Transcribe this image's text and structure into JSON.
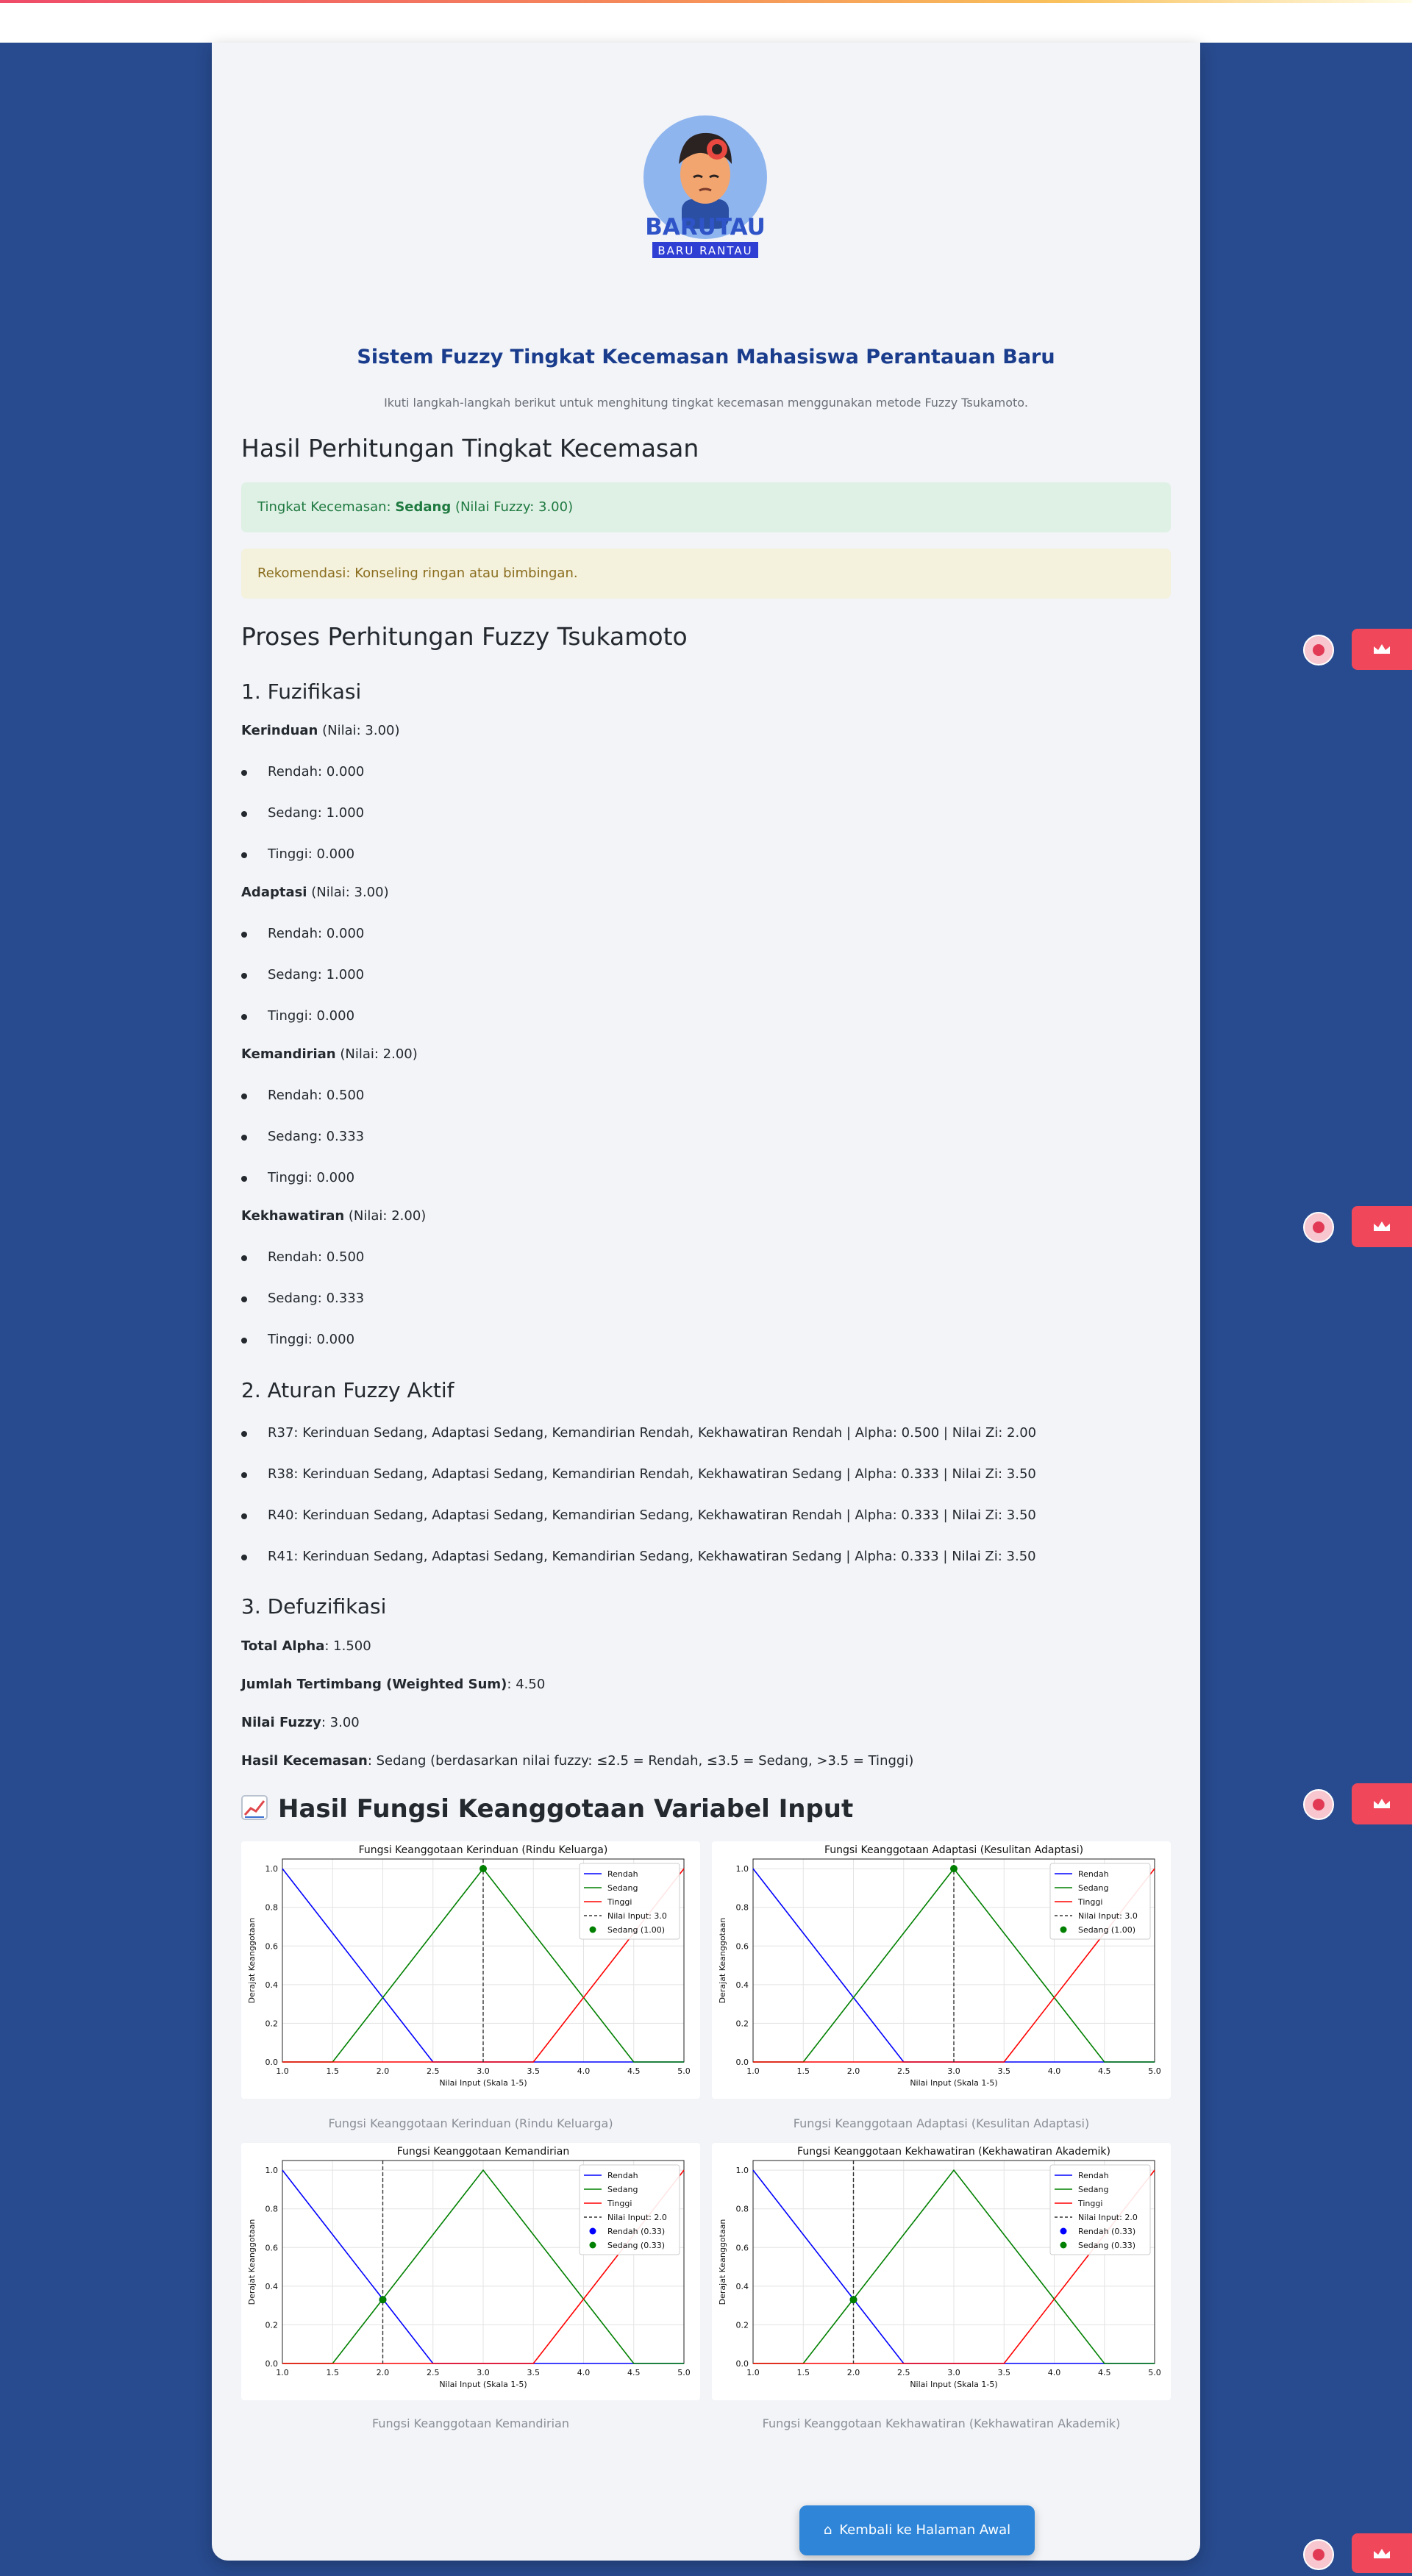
{
  "header": {
    "app_name": "BARUTAU",
    "app_tagline": "BARU RANTAU",
    "title": "Sistem Fuzzy Tingkat Kecemasan Mahasiswa Perantauan Baru",
    "subtitle": "Ikuti langkah-langkah berikut untuk menghitung tingkat kecemasan menggunakan metode Fuzzy Tsukamoto."
  },
  "result": {
    "heading": "Hasil Perhitungan Tingkat Kecemasan",
    "level_prefix": "Tingkat Kecemasan: ",
    "level_value": "Sedang",
    "level_suffix": " (Nilai Fuzzy: 3.00)",
    "recommendation": "Rekomendasi: Konseling ringan atau bimbingan."
  },
  "process": {
    "heading": "Proses Perhitungan Fuzzy Tsukamoto",
    "fuzzification_heading": "1. Fuzifikasi",
    "variables": [
      {
        "name": "Kerinduan",
        "value_text": " (Nilai: 3.00)",
        "memberships": [
          "Rendah: 0.000",
          "Sedang: 1.000",
          "Tinggi: 0.000"
        ]
      },
      {
        "name": "Adaptasi",
        "value_text": " (Nilai: 3.00)",
        "memberships": [
          "Rendah: 0.000",
          "Sedang: 1.000",
          "Tinggi: 0.000"
        ]
      },
      {
        "name": "Kemandirian",
        "value_text": " (Nilai: 2.00)",
        "memberships": [
          "Rendah: 0.500",
          "Sedang: 0.333",
          "Tinggi: 0.000"
        ]
      },
      {
        "name": "Kekhawatiran",
        "value_text": " (Nilai: 2.00)",
        "memberships": [
          "Rendah: 0.500",
          "Sedang: 0.333",
          "Tinggi: 0.000"
        ]
      }
    ],
    "rules_heading": "2. Aturan Fuzzy Aktif",
    "rules": [
      "R37: Kerinduan Sedang, Adaptasi Sedang, Kemandirian Rendah, Kekhawatiran Rendah | Alpha: 0.500 | Nilai Zi: 2.00",
      "R38: Kerinduan Sedang, Adaptasi Sedang, Kemandirian Rendah, Kekhawatiran Sedang | Alpha: 0.333 | Nilai Zi: 3.50",
      "R40: Kerinduan Sedang, Adaptasi Sedang, Kemandirian Sedang, Kekhawatiran Rendah | Alpha: 0.333 | Nilai Zi: 3.50",
      "R41: Kerinduan Sedang, Adaptasi Sedang, Kemandirian Sedang, Kekhawatiran Sedang | Alpha: 0.333 | Nilai Zi: 3.50"
    ],
    "defuzz_heading": "3. Defuzifikasi",
    "defuzz": [
      {
        "label": "Total Alpha",
        "value": ": 1.500"
      },
      {
        "label": "Jumlah Tertimbang (Weighted Sum)",
        "value": ": 4.50"
      },
      {
        "label": "Nilai Fuzzy",
        "value": ": 3.00"
      },
      {
        "label": "Hasil Kecemasan",
        "value": ": Sedang (berdasarkan nilai fuzzy: ≤2.5 = Rendah, ≤3.5 = Sedang, >3.5 = Tinggi)"
      }
    ]
  },
  "charts_section": {
    "heading": "Hasil Fungsi Keanggotaan Variabel Input",
    "back_button": "Kembali ke Halaman Awal"
  },
  "chart_data": [
    {
      "type": "line",
      "title": "Fungsi Keanggotaan Kerinduan (Rindu Keluarga)",
      "caption": "Fungsi Keanggotaan Kerinduan (Rindu Keluarga)",
      "xlabel": "Nilai Input (Skala 1-5)",
      "ylabel": "Derajat Keanggotaan",
      "xlim": [
        1.0,
        5.0
      ],
      "ylim": [
        0.0,
        1.05
      ],
      "xticks": [
        "1.0",
        "1.5",
        "2.0",
        "2.5",
        "3.0",
        "3.5",
        "4.0",
        "4.5",
        "5.0"
      ],
      "yticks": [
        "0.0",
        "0.2",
        "0.4",
        "0.6",
        "0.8",
        "1.0"
      ],
      "grid": true,
      "legend": "top-right",
      "series": [
        {
          "name": "Rendah",
          "color": "#0000ff",
          "x": [
            1.0,
            2.5,
            5.0
          ],
          "y": [
            1.0,
            0.0,
            0.0
          ]
        },
        {
          "name": "Sedang",
          "color": "#008000",
          "x": [
            1.0,
            1.5,
            3.0,
            4.5,
            5.0
          ],
          "y": [
            0.0,
            0.0,
            1.0,
            0.0,
            0.0
          ]
        },
        {
          "name": "Tinggi",
          "color": "#ff0000",
          "x": [
            1.0,
            3.5,
            5.0
          ],
          "y": [
            0.0,
            0.0,
            1.0
          ]
        }
      ],
      "input_line": {
        "name": "Nilai Input: 3.0",
        "x": 3.0
      },
      "points": [
        {
          "name": "Sedang (1.00)",
          "x": 3.0,
          "y": 1.0,
          "color": "#008000"
        }
      ]
    },
    {
      "type": "line",
      "title": "Fungsi Keanggotaan Adaptasi (Kesulitan Adaptasi)",
      "caption": "Fungsi Keanggotaan Adaptasi (Kesulitan Adaptasi)",
      "xlabel": "Nilai Input (Skala 1-5)",
      "ylabel": "Derajat Keanggotaan",
      "xlim": [
        1.0,
        5.0
      ],
      "ylim": [
        0.0,
        1.05
      ],
      "xticks": [
        "1.0",
        "1.5",
        "2.0",
        "2.5",
        "3.0",
        "3.5",
        "4.0",
        "4.5",
        "5.0"
      ],
      "yticks": [
        "0.0",
        "0.2",
        "0.4",
        "0.6",
        "0.8",
        "1.0"
      ],
      "grid": true,
      "legend": "top-right",
      "series": [
        {
          "name": "Rendah",
          "color": "#0000ff",
          "x": [
            1.0,
            2.5,
            5.0
          ],
          "y": [
            1.0,
            0.0,
            0.0
          ]
        },
        {
          "name": "Sedang",
          "color": "#008000",
          "x": [
            1.0,
            1.5,
            3.0,
            4.5,
            5.0
          ],
          "y": [
            0.0,
            0.0,
            1.0,
            0.0,
            0.0
          ]
        },
        {
          "name": "Tinggi",
          "color": "#ff0000",
          "x": [
            1.0,
            3.5,
            5.0
          ],
          "y": [
            0.0,
            0.0,
            1.0
          ]
        }
      ],
      "input_line": {
        "name": "Nilai Input: 3.0",
        "x": 3.0
      },
      "points": [
        {
          "name": "Sedang (1.00)",
          "x": 3.0,
          "y": 1.0,
          "color": "#008000"
        }
      ]
    },
    {
      "type": "line",
      "title": "Fungsi Keanggotaan Kemandirian",
      "caption": "Fungsi Keanggotaan Kemandirian",
      "xlabel": "Nilai Input (Skala 1-5)",
      "ylabel": "Derajat Keanggotaan",
      "xlim": [
        1.0,
        5.0
      ],
      "ylim": [
        0.0,
        1.05
      ],
      "xticks": [
        "1.0",
        "1.5",
        "2.0",
        "2.5",
        "3.0",
        "3.5",
        "4.0",
        "4.5",
        "5.0"
      ],
      "yticks": [
        "0.0",
        "0.2",
        "0.4",
        "0.6",
        "0.8",
        "1.0"
      ],
      "grid": true,
      "legend": "top-right",
      "series": [
        {
          "name": "Rendah",
          "color": "#0000ff",
          "x": [
            1.0,
            2.5,
            5.0
          ],
          "y": [
            1.0,
            0.0,
            0.0
          ]
        },
        {
          "name": "Sedang",
          "color": "#008000",
          "x": [
            1.0,
            1.5,
            3.0,
            4.5,
            5.0
          ],
          "y": [
            0.0,
            0.0,
            1.0,
            0.0,
            0.0
          ]
        },
        {
          "name": "Tinggi",
          "color": "#ff0000",
          "x": [
            1.0,
            3.5,
            5.0
          ],
          "y": [
            0.0,
            0.0,
            1.0
          ]
        }
      ],
      "input_line": {
        "name": "Nilai Input: 2.0",
        "x": 2.0
      },
      "points": [
        {
          "name": "Rendah (0.33)",
          "x": 2.0,
          "y": 0.33,
          "color": "#0000ff"
        },
        {
          "name": "Sedang (0.33)",
          "x": 2.0,
          "y": 0.33,
          "color": "#008000"
        }
      ]
    },
    {
      "type": "line",
      "title": "Fungsi Keanggotaan Kekhawatiran (Kekhawatiran Akademik)",
      "caption": "Fungsi Keanggotaan Kekhawatiran (Kekhawatiran Akademik)",
      "xlabel": "Nilai Input (Skala 1-5)",
      "ylabel": "Derajat Keanggotaan",
      "xlim": [
        1.0,
        5.0
      ],
      "ylim": [
        0.0,
        1.05
      ],
      "xticks": [
        "1.0",
        "1.5",
        "2.0",
        "2.5",
        "3.0",
        "3.5",
        "4.0",
        "4.5",
        "5.0"
      ],
      "yticks": [
        "0.0",
        "0.2",
        "0.4",
        "0.6",
        "0.8",
        "1.0"
      ],
      "grid": true,
      "legend": "top-right",
      "series": [
        {
          "name": "Rendah",
          "color": "#0000ff",
          "x": [
            1.0,
            2.5,
            5.0
          ],
          "y": [
            1.0,
            0.0,
            0.0
          ]
        },
        {
          "name": "Sedang",
          "color": "#008000",
          "x": [
            1.0,
            1.5,
            3.0,
            4.5,
            5.0
          ],
          "y": [
            0.0,
            0.0,
            1.0,
            0.0,
            0.0
          ]
        },
        {
          "name": "Tinggi",
          "color": "#ff0000",
          "x": [
            1.0,
            3.5,
            5.0
          ],
          "y": [
            0.0,
            0.0,
            1.0
          ]
        }
      ],
      "input_line": {
        "name": "Nilai Input: 2.0",
        "x": 2.0
      },
      "points": [
        {
          "name": "Rendah (0.33)",
          "x": 2.0,
          "y": 0.33,
          "color": "#0000ff"
        },
        {
          "name": "Sedang (0.33)",
          "x": 2.0,
          "y": 0.33,
          "color": "#008000"
        }
      ]
    }
  ],
  "colors": {
    "page_background": "#284b8f",
    "card_background": "#f2f4f8",
    "title": "#1a3c8c",
    "success_bg": "#dff0e5",
    "success_text": "#1f7a40",
    "warning_bg": "#f4f1dc",
    "warning_text": "#8a6d1e",
    "button": "#2f86d9",
    "side_tab": "#f0485a"
  },
  "icons": {
    "logo": "anxious-student-avatar",
    "charts_heading": "chart-increasing-emoji",
    "back_button": "house-emoji",
    "side_badge": "pink-circle-badge-icon",
    "side_tab": "crown-icon"
  }
}
